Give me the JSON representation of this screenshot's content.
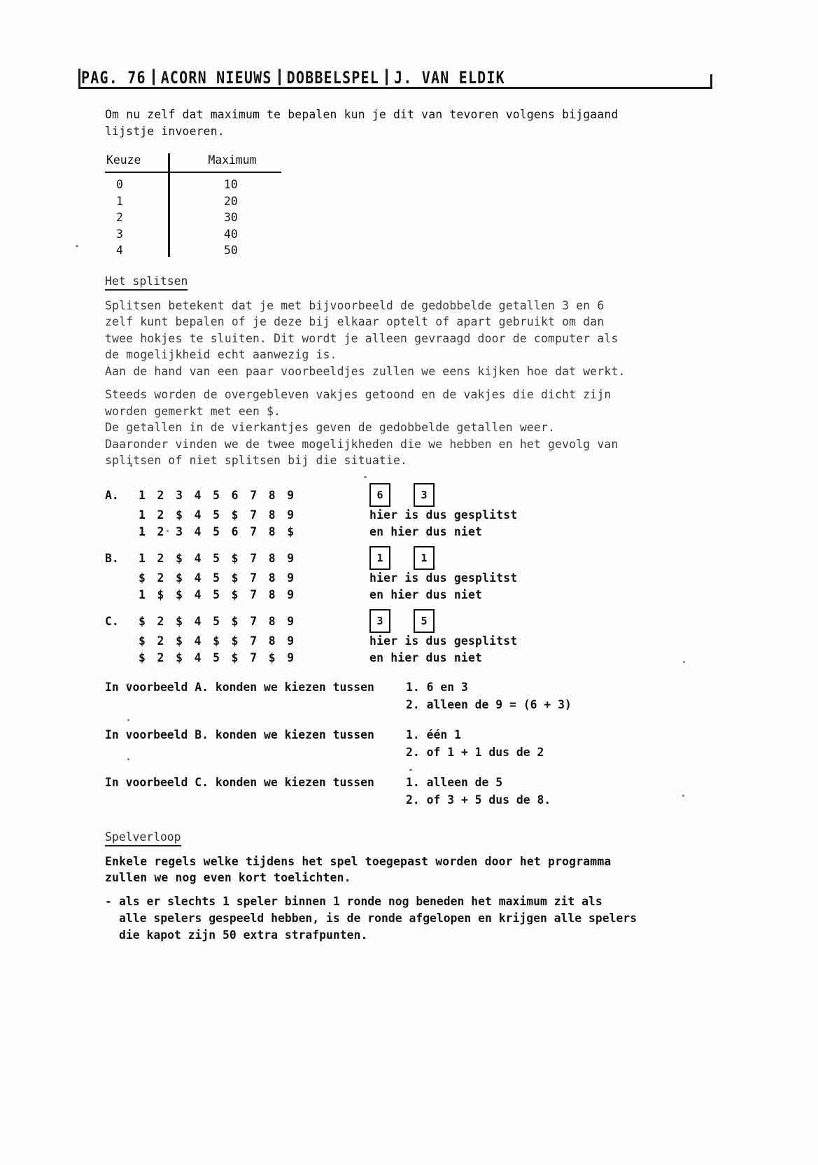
{
  "masthead": {
    "page": "PAG. 76",
    "publication": "ACORN NIEUWS",
    "article": "DOBBELSPEL",
    "author": "J. VAN ELDIK"
  },
  "intro": {
    "paragraph": "Om nu zelf dat maximum te bepalen kun je dit van tevoren volgens bijgaand\nlijstje invoeren."
  },
  "keuze_table": {
    "col_keuze": "Keuze",
    "col_maximum": "Maximum",
    "rows": [
      {
        "keuze": "0",
        "maximum": "10"
      },
      {
        "keuze": "1",
        "maximum": "20"
      },
      {
        "keuze": "2",
        "maximum": "30"
      },
      {
        "keuze": "3",
        "maximum": "40"
      },
      {
        "keuze": "4",
        "maximum": "50"
      }
    ]
  },
  "splitsen": {
    "heading": "Het splitsen",
    "p1": "Splitsen betekent dat je met bijvoorbeeld de gedobbelde getallen 3 en 6\nzelf kunt bepalen of je deze bij elkaar optelt of apart gebruikt om dan\ntwee hokjes te sluiten. Dit wordt je alleen gevraagd door de computer als\nde mogelijkheid echt aanwezig is.\nAan de hand van een paar voorbeeldjes zullen we eens kijken hoe dat werkt.",
    "p2": "Steeds worden de overgebleven vakjes getoond en de vakjes die dicht zijn\nworden gemerkt met een $.\nDe getallen in de vierkantjes geven de gedobbelde getallen weer.\nDaaronder vinden we de twee mogelijkheden die we hebben en het gevolg van\nsplitsen of niet splitsen bij die situatie."
  },
  "examples": [
    {
      "label": "A.",
      "sequence": "1 2 3 4 5 6 7 8 9",
      "dice": [
        "6",
        "3"
      ],
      "lines": [
        {
          "sequence": "1 2 $ 4 5 $ 7 8 9",
          "note": "hier is dus gesplitst"
        },
        {
          "sequence": "1 2 3 4 5 6 7 8 $",
          "note": "en hier dus niet"
        }
      ]
    },
    {
      "label": "B.",
      "sequence": "1 2 $ 4 5 $ 7 8 9",
      "dice": [
        "1",
        "1"
      ],
      "lines": [
        {
          "sequence": "$ 2 $ 4 5 $ 7 8 9",
          "note": "hier is dus gesplitst"
        },
        {
          "sequence": "1 $ $ 4 5 $ 7 8 9",
          "note": "en hier dus niet"
        }
      ]
    },
    {
      "label": "C.",
      "sequence": "$ 2 $ 4 5 $ 7 8 9",
      "dice": [
        "3",
        "5"
      ],
      "lines": [
        {
          "sequence": "$ 2 $ 4 $ $ 7 8 9",
          "note": "hier is dus gesplitst"
        },
        {
          "sequence": "$ 2 $ 4 5 $ 7 $ 9",
          "note": "en hier dus niet"
        }
      ]
    }
  ],
  "conclusions": [
    {
      "lead": "In voorbeeld A. konden we kiezen tussen",
      "option1": "1.  6 en 3",
      "option2": "2. alleen de 9 = (6 + 3)"
    },
    {
      "lead": "In voorbeeld B. konden we kiezen tussen",
      "option1": "1. één 1",
      "option2": "2. of 1 + 1 dus de 2"
    },
    {
      "lead": "In voorbeeld C. konden we kiezen tussen",
      "option1": "1. alleen de 5",
      "option2": "2. of 3 + 5 dus de 8."
    }
  ],
  "spelverloop": {
    "heading": "Spelverloop",
    "intro": "Enkele regels welke tijdens het spel toegepast worden door het programma\nzullen we nog even kort toelichten.",
    "bullet_mark": "-",
    "bullet_text": "als er slechts 1 speler binnen 1 ronde nog beneden het maximum zit als\nalle spelers gespeeld hebben, is de ronde afgelopen en krijgen alle spelers\ndie kapot zijn 50 extra strafpunten."
  }
}
